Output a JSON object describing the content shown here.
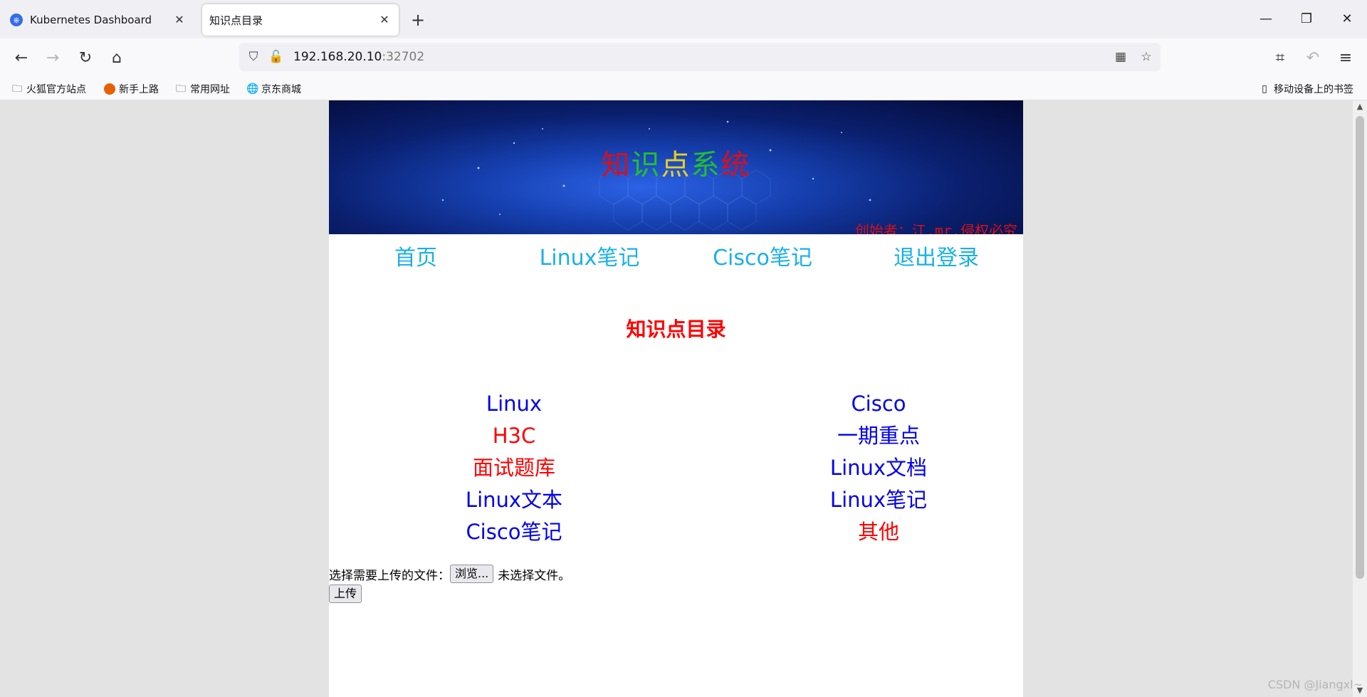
{
  "browser": {
    "tabs": [
      {
        "title": "Kubernetes Dashboard",
        "icon": "kubernetes-icon",
        "active": false
      },
      {
        "title": "知识点目录",
        "active": true
      }
    ],
    "address": {
      "host": "192.168.20.10",
      "port": ":32702"
    },
    "bookmarks": [
      {
        "label": "火狐官方站点",
        "icon": "folder-icon"
      },
      {
        "label": "新手上路",
        "icon": "firefox-icon"
      },
      {
        "label": "常用网址",
        "icon": "folder-icon"
      },
      {
        "label": "京东商城",
        "icon": "globe-icon"
      }
    ],
    "mobile_bookmarks": "移动设备上的书签"
  },
  "banner": {
    "title_chars": [
      {
        "ch": "知",
        "color": "#d8101a"
      },
      {
        "ch": "识",
        "color": "#22c02a"
      },
      {
        "ch": "点",
        "color": "#e8d020"
      },
      {
        "ch": "系",
        "color": "#22c02a"
      },
      {
        "ch": "统",
        "color": "#d8101a"
      }
    ],
    "creator": "创始者：江.mr.侵权必究"
  },
  "menu": [
    "首页",
    "Linux笔记",
    "Cisco笔记",
    "退出登录"
  ],
  "heading": "知识点目录",
  "catalog": {
    "left": [
      {
        "label": "Linux",
        "color": "#0000ee"
      },
      {
        "label": "H3C",
        "color": "#ff0000"
      },
      {
        "label": "面试题库",
        "color": "#ff0000"
      },
      {
        "label": "Linux文本",
        "color": "#0000ee"
      },
      {
        "label": "Cisco笔记",
        "color": "#0000ee"
      }
    ],
    "right": [
      {
        "label": "Cisco",
        "color": "#0000ee"
      },
      {
        "label": "一期重点",
        "color": "#0000ee"
      },
      {
        "label": "Linux文档",
        "color": "#0000ee"
      },
      {
        "label": "Linux笔记",
        "color": "#0000ee"
      },
      {
        "label": "其他",
        "color": "#ff0000"
      }
    ]
  },
  "upload": {
    "label": "选择需要上传的文件：",
    "browse_button": "浏览...",
    "no_file": "未选择文件。",
    "submit_button": "上传"
  },
  "watermark": "CSDN @Jiangxl~"
}
